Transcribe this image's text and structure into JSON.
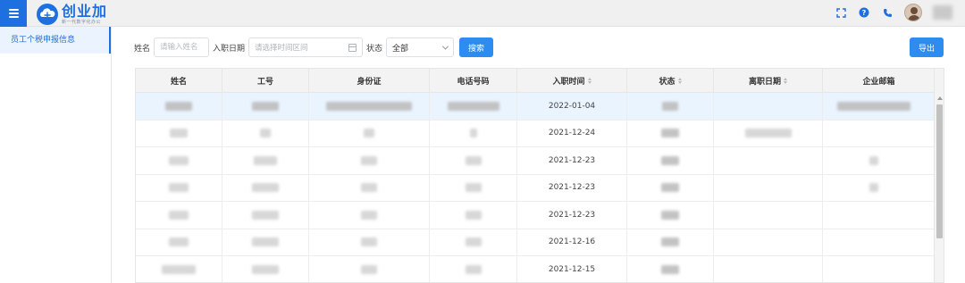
{
  "app": {
    "logo_title": "创业加",
    "logo_subtitle": "新一代数字化办公"
  },
  "sidebar": {
    "items": [
      {
        "label": "员工个税申报信息",
        "active": true
      }
    ]
  },
  "filters": {
    "name_label": "姓名",
    "name_placeholder": "请输入姓名",
    "hire_date_label": "入职日期",
    "hire_date_placeholder": "请选择时间区间",
    "status_label": "状态",
    "status_value": "全部",
    "search_label": "搜索",
    "export_label": "导出"
  },
  "table": {
    "columns": [
      {
        "label": "姓名",
        "sortable": false
      },
      {
        "label": "工号",
        "sortable": false
      },
      {
        "label": "身份证",
        "sortable": false
      },
      {
        "label": "电话号码",
        "sortable": false
      },
      {
        "label": "入职时间",
        "sortable": true
      },
      {
        "label": "状态",
        "sortable": true
      },
      {
        "label": "离职日期",
        "sortable": true
      },
      {
        "label": "企业邮箱",
        "sortable": false
      }
    ],
    "rows": [
      {
        "hire_date": "2022-01-04",
        "selected": true
      },
      {
        "hire_date": "2021-12-24",
        "selected": false
      },
      {
        "hire_date": "2021-12-23",
        "selected": false
      },
      {
        "hire_date": "2021-12-23",
        "selected": false
      },
      {
        "hire_date": "2021-12-23",
        "selected": false
      },
      {
        "hire_date": "2021-12-16",
        "selected": false
      },
      {
        "hire_date": "2021-12-15",
        "selected": false
      }
    ]
  },
  "colors": {
    "brand": "#1e6fe0",
    "primary_button": "#2d8cf0",
    "selected_row": "#eaf4ff"
  },
  "icons": {
    "menu": "hamburger-icon",
    "fullscreen": "fullscreen-icon",
    "help": "help-icon",
    "phone": "phone-icon",
    "calendar": "calendar-icon",
    "dropdown": "chevron-down-icon"
  }
}
